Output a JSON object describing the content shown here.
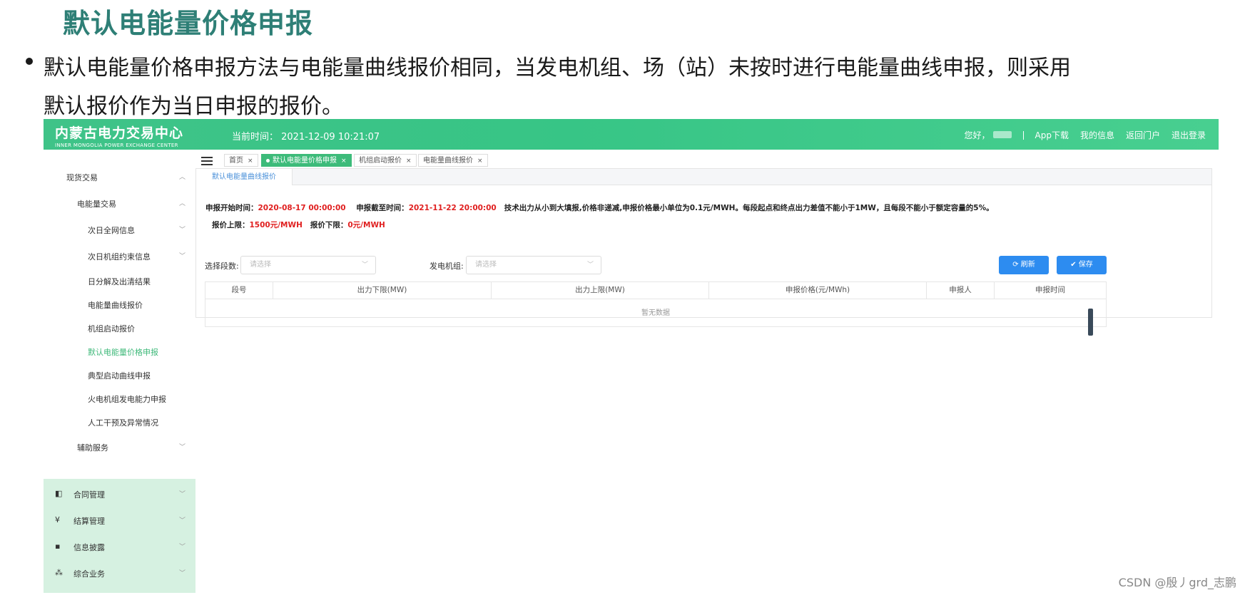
{
  "slide": {
    "title": "默认电能量价格申报",
    "bullet_line1": "默认电能量价格申报方法与电能量曲线报价相同，当发电机组、场（站）未按时进行电能量曲线申报，则采用",
    "bullet_line2": "默认报价作为当日申报的报价。"
  },
  "header": {
    "logo_cn": "内蒙古电力交易中心",
    "logo_en": "INNER MONGOLIA POWER EXCHANGE CENTER",
    "current_time": "当前时间： 2021-12-09 10:21:07",
    "greeting": "您好，",
    "links": [
      "App下载",
      "我的信息",
      "返回门户",
      "退出登录"
    ]
  },
  "sidebar": {
    "items": [
      {
        "label": "现货交易",
        "chevron": "︿"
      },
      {
        "label": "电能量交易",
        "chevron": "︿"
      },
      {
        "label": "次日全网信息",
        "chevron": "﹀"
      },
      {
        "label": "次日机组约束信息",
        "chevron": "﹀"
      },
      {
        "label": "日分解及出清结果",
        "chevron": ""
      },
      {
        "label": "电能量曲线报价",
        "chevron": ""
      },
      {
        "label": "机组启动报价",
        "chevron": ""
      },
      {
        "label": "默认电能量价格申报",
        "chevron": ""
      },
      {
        "label": "典型启动曲线申报",
        "chevron": ""
      },
      {
        "label": "火电机组发电能力申报",
        "chevron": ""
      },
      {
        "label": "人工干预及异常情况",
        "chevron": ""
      },
      {
        "label": "辅助服务",
        "chevron": "﹀"
      }
    ],
    "groups": [
      {
        "label": "合同管理",
        "icon": "◧"
      },
      {
        "label": "结算管理",
        "icon": "¥"
      },
      {
        "label": "信息披露",
        "icon": "▪"
      },
      {
        "label": "综合业务",
        "icon": "⁂"
      }
    ],
    "group_chevron": "﹀"
  },
  "tabs": {
    "items": [
      {
        "label": "首页"
      },
      {
        "label": "默认电能量价格申报"
      },
      {
        "label": "机组启动报价"
      },
      {
        "label": "电能量曲线报价"
      }
    ],
    "close": "×"
  },
  "panel": {
    "tab_label": "默认电能量曲线报价",
    "start_label": "申报开始时间：",
    "start_value": "2020-08-17 00:00:00",
    "end_label": "申报截至时间：",
    "end_value": "2021-11-22 20:00:00",
    "rule_text": "技术出力从小到大填报,价格非递减,申报价格最小单位为0.1元/MWH。每段起点和终点出力差值不能小于1MW，且每段不能小于额定容量的5%。",
    "upper_label": "报价上限：",
    "upper_value": "1500元/MWH",
    "lower_label": "报价下限：",
    "lower_value": "0元/MWH",
    "segment_label": "选择段数:",
    "segment_placeholder": "请选择",
    "unit_label": "发电机组:",
    "unit_placeholder": "请选择",
    "refresh_label": "刷新",
    "save_label": "保存",
    "columns": [
      "段号",
      "出力下限(MW)",
      "出力上限(MW)",
      "申报价格(元/MWh)",
      "申报人",
      "申报时间"
    ],
    "empty_text": "暂无数据"
  },
  "watermark": "CSDN @殷丿grd_志鹏",
  "colors": {
    "title": "#2e7f76",
    "header_green": "#3fc388",
    "active_tab": "#3dbb7a",
    "button_blue": "#2d8cf0",
    "highlight_red": "#e02020"
  }
}
